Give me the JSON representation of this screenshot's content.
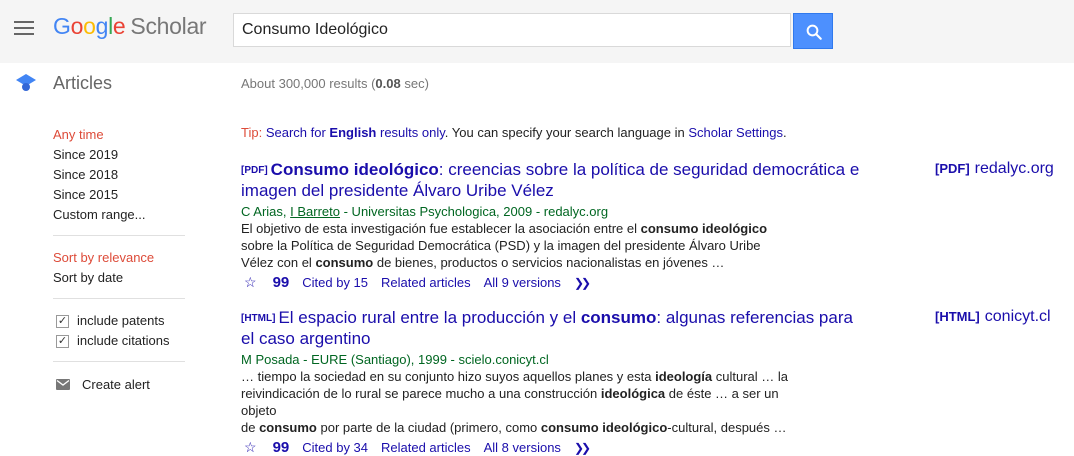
{
  "header": {
    "logo_google": [
      "G",
      "o",
      "o",
      "g",
      "l",
      "e"
    ],
    "logo_scholar": "Scholar",
    "search_value": "Consumo Ideológico"
  },
  "subheader": {
    "section": "Articles",
    "stats_prefix": "About 300,000 results (",
    "stats_time": "0.08",
    "stats_suffix": " sec)"
  },
  "sidebar": {
    "time_filters": [
      "Any time",
      "Since 2019",
      "Since 2018",
      "Since 2015",
      "Custom range..."
    ],
    "sort_options": [
      "Sort by relevance",
      "Sort by date"
    ],
    "include_patents": "include patents",
    "include_citations": "include citations",
    "create_alert": "Create alert"
  },
  "tip": {
    "label": "Tip:",
    "part1": "Search for ",
    "bold": "English",
    "part2": " results only",
    "part3": ". You can specify your search language in ",
    "settings_link": "Scholar Settings",
    "end": "."
  },
  "results": [
    {
      "tag": "[PDF]",
      "title_bold": "Consumo ideológico",
      "title_rest": ": creencias sobre la política de seguridad democrática e imagen del presidente Álvaro Uribe Vélez",
      "author1": "C Arias",
      "author2": "I Barreto",
      "source": " - Universitas Psychologica, 2009 - redalyc.org",
      "snippet_lines": [
        [
          "El objetivo de esta investigación fue establecer la asociación entre el ",
          "consumo ideológico",
          ""
        ],
        [
          "sobre la Política de Seguridad Democrática (PSD) y la imagen del presidente Álvaro Uribe",
          "",
          ""
        ],
        [
          "Vélez con el ",
          "consumo",
          " de bienes, productos o servicios nacionalistas en jóvenes …"
        ]
      ],
      "cited": "Cited by 15",
      "related": "Related articles",
      "versions": "All 9 versions",
      "side_tag": "[PDF]",
      "side_domain": "redalyc.org"
    },
    {
      "tag": "[HTML]",
      "title_pre": "El espacio rural entre la producción y el ",
      "title_bold": "consumo",
      "title_rest": ": algunas referencias para el caso argentino",
      "authors": "M Posada - EURE (Santiago), 1999 - scielo.conicyt.cl",
      "snippet_lines": [
        [
          "… tiempo la sociedad en su conjunto hizo suyos aquellos planes y esta ",
          "ideología",
          " cultural … la"
        ],
        [
          "reivindicación de lo rural se parece mucho a una construcción ",
          "ideológica",
          " de éste … a ser un objeto"
        ],
        [
          "de ",
          "consumo",
          " por parte de la ciudad (primero, como "
        ],
        [
          "consumo ideológico",
          "-cultural, después …",
          ""
        ]
      ],
      "cited": "Cited by 34",
      "related": "Related articles",
      "versions": "All 8 versions",
      "side_tag": "[HTML]",
      "side_domain": "conicyt.cl"
    }
  ],
  "colors": {
    "link": "#1a0dab",
    "green": "#006621",
    "active_red": "#dd4b39",
    "search_blue": "#4d90fe"
  }
}
